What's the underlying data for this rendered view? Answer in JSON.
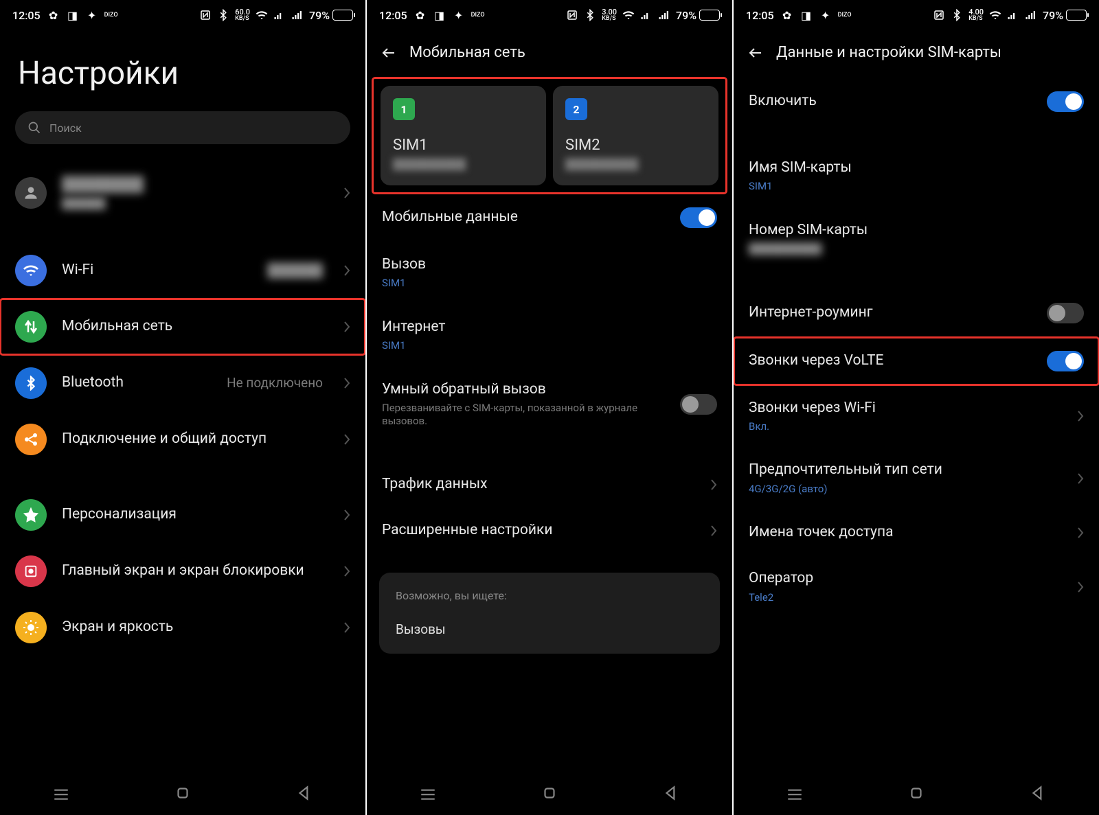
{
  "status": {
    "time": "12:05",
    "battery_pct": "79%",
    "speeds": [
      "60.0",
      "3.00",
      "4.00"
    ],
    "speed_unit": "KB/S"
  },
  "colors": {
    "accent_blue": "#1a6dd8",
    "highlight_red": "#e8332b",
    "wifi_bg": "#3b6fe0",
    "mobile_bg": "#2ea84f",
    "bt_bg": "#1a6dd8",
    "share_bg": "#f58a1f",
    "pers_bg": "#2ea84f",
    "home_bg": "#d9364a",
    "disp_bg": "#f5b01f"
  },
  "screen1": {
    "title": "Настройки",
    "search_placeholder": "Поиск",
    "profile_name": "████████",
    "profile_sub": "██████",
    "items": {
      "wifi": "Wi-Fi",
      "wifi_value": "██████",
      "mobile": "Мобильная сеть",
      "bluetooth": "Bluetooth",
      "bluetooth_value": "Не подключено",
      "share": "Подключение и общий доступ",
      "personalization": "Персонализация",
      "home": "Главный экран и экран блокировки",
      "display": "Экран и яркость"
    }
  },
  "screen2": {
    "title": "Мобильная сеть",
    "sim1": {
      "name": "SIM1",
      "num": "1",
      "sub": "██████████"
    },
    "sim2": {
      "name": "SIM2",
      "num": "2",
      "sub": "██████████"
    },
    "mobile_data": "Мобильные данные",
    "call": {
      "label": "Вызов",
      "value": "SIM1"
    },
    "internet": {
      "label": "Интернет",
      "value": "SIM1"
    },
    "smart_callback": {
      "label": "Умный обратный вызов",
      "desc": "Перезванивайте с SIM-карты, показанной в журнале вызовов."
    },
    "traffic": "Трафик данных",
    "advanced": "Расширенные настройки",
    "suggest_title": "Возможно, вы ищете:",
    "suggest_item": "Вызовы"
  },
  "screen3": {
    "title": "Данные и настройки SIM-карты",
    "enable": "Включить",
    "sim_name": {
      "label": "Имя SIM-карты",
      "value": "SIM1"
    },
    "sim_number": {
      "label": "Номер SIM-карты",
      "value": "██████████"
    },
    "roaming": "Интернет-роуминг",
    "volte": "Звонки через VoLTE",
    "wifi_call": {
      "label": "Звонки через Wi-Fi",
      "value": "Вкл."
    },
    "net_type": {
      "label": "Предпочтительный тип сети",
      "value": "4G/3G/2G (авто)"
    },
    "apn": "Имена точек доступа",
    "operator": {
      "label": "Оператор",
      "value": "Tele2"
    }
  }
}
